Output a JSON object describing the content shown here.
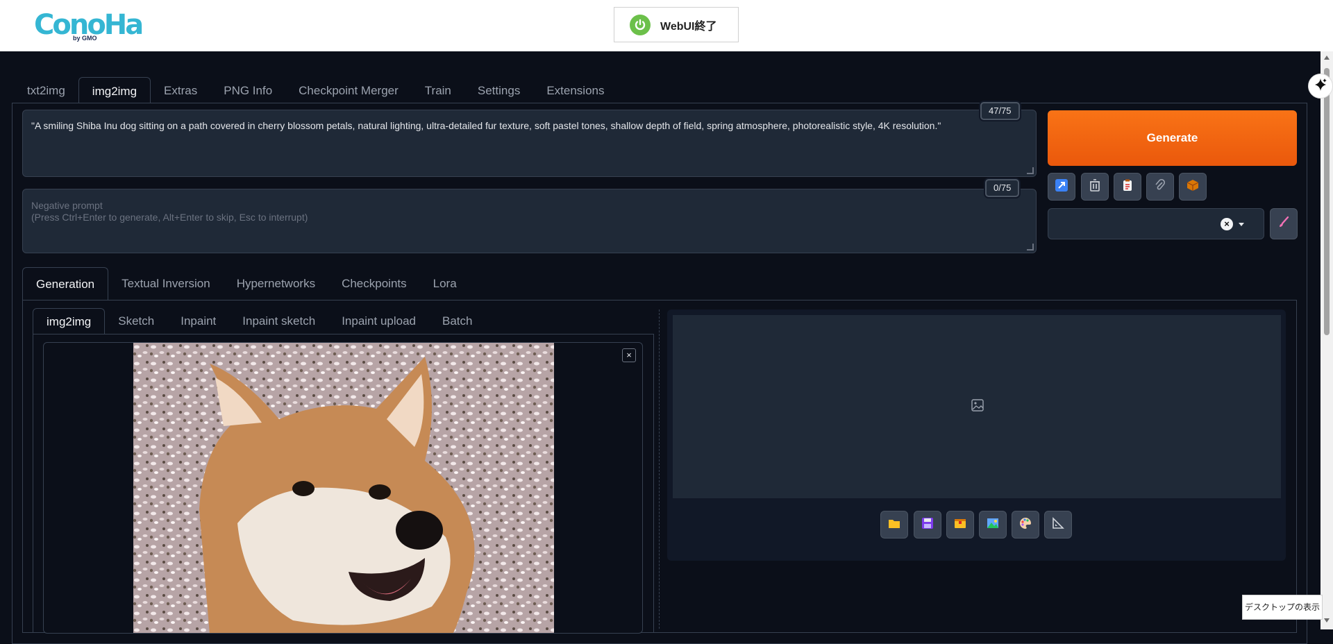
{
  "header": {
    "logo_text": "ConoHa",
    "logo_sub": "by GMO",
    "exit_button_label": "WebUI終了"
  },
  "main_tabs": [
    {
      "label": "txt2img"
    },
    {
      "label": "img2img"
    },
    {
      "label": "Extras"
    },
    {
      "label": "PNG Info"
    },
    {
      "label": "Checkpoint Merger"
    },
    {
      "label": "Train"
    },
    {
      "label": "Settings"
    },
    {
      "label": "Extensions"
    }
  ],
  "prompt": {
    "value": "\"A smiling Shiba Inu dog sitting on a path covered in cherry blossom petals, natural lighting, ultra-detailed fur texture, soft pastel tones, shallow depth of field, spring atmosphere, photorealistic style, 4K resolution.\"",
    "token_count": "47/75"
  },
  "negative_prompt": {
    "placeholder": "Negative prompt\n(Press Ctrl+Enter to generate, Alt+Enter to skip, Esc to interrupt)",
    "token_count": "0/75"
  },
  "actions": {
    "generate_label": "Generate",
    "clear_symbol": "×"
  },
  "sub_tabs": [
    {
      "label": "Generation"
    },
    {
      "label": "Textual Inversion"
    },
    {
      "label": "Hypernetworks"
    },
    {
      "label": "Checkpoints"
    },
    {
      "label": "Lora"
    }
  ],
  "inner_tabs": [
    {
      "label": "img2img"
    },
    {
      "label": "Sketch"
    },
    {
      "label": "Inpaint"
    },
    {
      "label": "Inpaint sketch"
    },
    {
      "label": "Inpaint upload"
    },
    {
      "label": "Batch"
    }
  ],
  "image_close_symbol": "×",
  "taskbar_tooltip": "デスクトップの表示",
  "colors": {
    "background": "#0b0f19",
    "accent": "#f97316",
    "border": "#374151"
  }
}
